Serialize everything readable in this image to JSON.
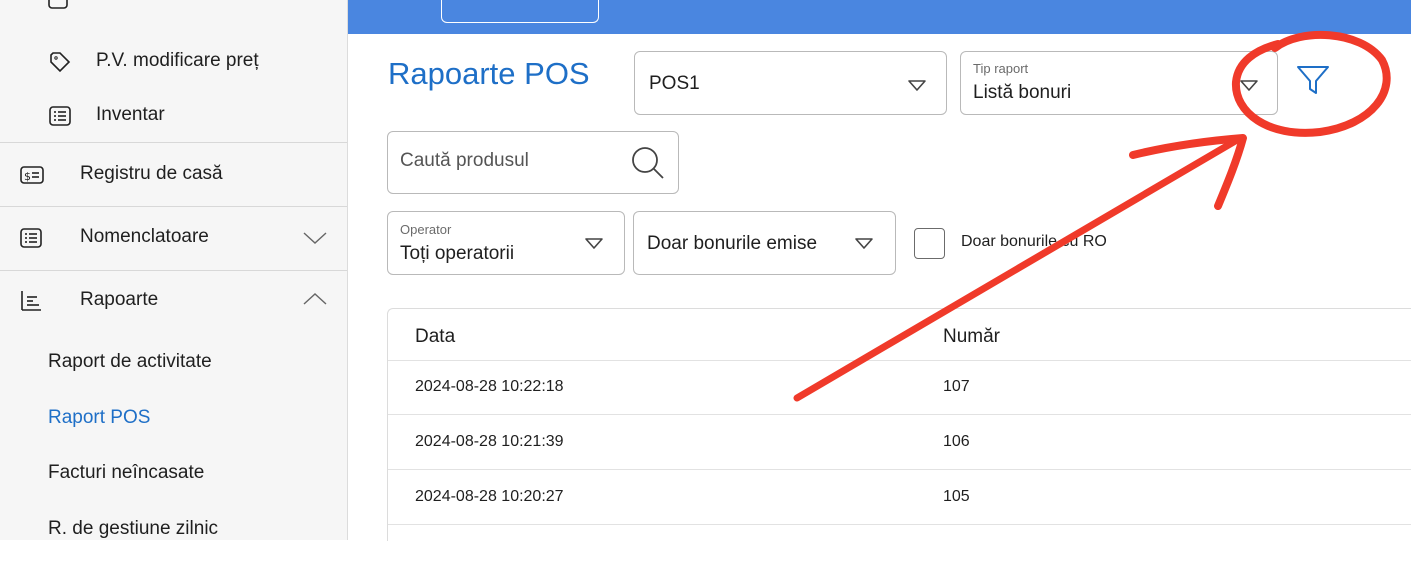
{
  "sidebar": {
    "items": [
      {
        "label": "P.V. modificare preț",
        "icon": "tag-icon"
      },
      {
        "label": "Inventar",
        "icon": "list-icon"
      },
      {
        "label": "Registru de casă",
        "icon": "cash-register-icon"
      },
      {
        "label": "Nomenclatoare",
        "icon": "list-icon"
      },
      {
        "label": "Rapoarte",
        "icon": "report-icon"
      }
    ],
    "subitems": [
      {
        "label": "Raport de activitate"
      },
      {
        "label": "Raport POS"
      },
      {
        "label": "Facturi neîncasate"
      },
      {
        "label": "R. de gestiune zilnic"
      }
    ]
  },
  "main": {
    "title": "Rapoarte POS",
    "pos_select": "POS1",
    "report_type": {
      "label": "Tip raport",
      "value": "Listă bonuri"
    },
    "search_placeholder": "Caută produsul",
    "operator": {
      "label": "Operator",
      "value": "Toți operatorii"
    },
    "status_filter": "Doar bonurile emise",
    "checkbox_label": "Doar bonurile cu RO",
    "table": {
      "headers": [
        "Data",
        "Număr"
      ],
      "rows": [
        [
          "2024-08-28 10:22:18",
          "107"
        ],
        [
          "2024-08-28 10:21:39",
          "106"
        ],
        [
          "2024-08-28 10:20:27",
          "105"
        ]
      ]
    }
  },
  "colors": {
    "accent": "#1e6fc7",
    "topbar": "#4a86e0",
    "annotation": "#f03a2a"
  }
}
